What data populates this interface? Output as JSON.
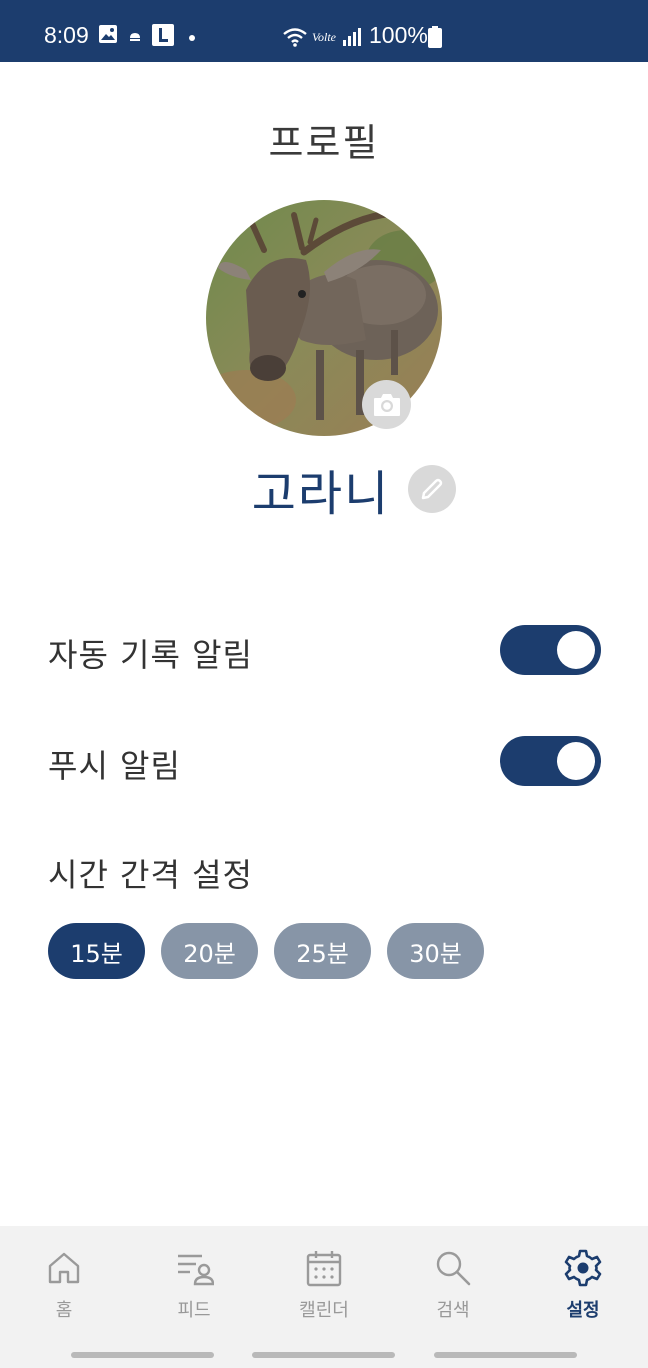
{
  "status_bar": {
    "time": "8:09",
    "network": "Volte",
    "battery": "100%",
    "icons": [
      "image-icon",
      "cloud-icon",
      "l-app-icon",
      "dot-icon",
      "wifi-icon",
      "signal-icon",
      "battery-icon"
    ]
  },
  "header": {
    "title": "프로필"
  },
  "profile": {
    "name": "고라니",
    "avatar_icon": "deer-photo",
    "camera_icon": "camera-icon",
    "edit_icon": "pencil-icon"
  },
  "settings": {
    "auto_record": {
      "label": "자동 기록 알림",
      "enabled": true
    },
    "push": {
      "label": "푸시 알림",
      "enabled": true
    },
    "interval": {
      "label": "시간 간격 설정",
      "options": [
        "15분",
        "20분",
        "25분",
        "30분"
      ],
      "selected": "15분"
    }
  },
  "nav": {
    "items": [
      {
        "label": "홈",
        "icon": "home-icon"
      },
      {
        "label": "피드",
        "icon": "feed-icon"
      },
      {
        "label": "캘린더",
        "icon": "calendar-icon"
      },
      {
        "label": "검색",
        "icon": "search-icon"
      },
      {
        "label": "설정",
        "icon": "gear-icon"
      }
    ],
    "active": "설정"
  },
  "colors": {
    "primary": "#1c3d6e",
    "chip_inactive": "#8795a7",
    "icon_bg": "#d9d9d9",
    "nav_bg": "#f2f2f2"
  }
}
